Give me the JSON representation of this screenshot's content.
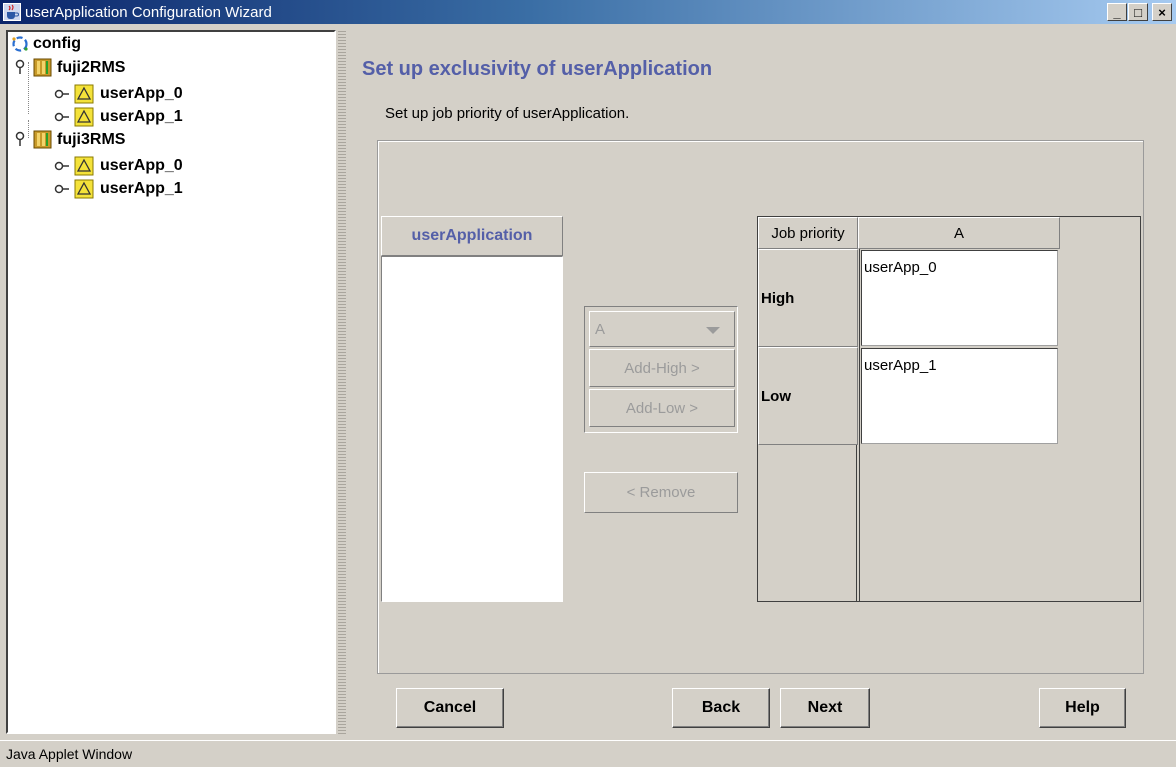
{
  "window": {
    "title": "userApplication Configuration Wizard",
    "icon": "java-cup-icon",
    "controls": [
      "_",
      "□",
      "×"
    ]
  },
  "tree": {
    "root": {
      "label": "config",
      "icon": "config-icon"
    },
    "nodes": [
      {
        "label": "fuji2RMS",
        "icon": "node-icon",
        "children": [
          {
            "label": "userApp_0",
            "icon": "userapp-icon"
          },
          {
            "label": "userApp_1",
            "icon": "userapp-icon"
          }
        ]
      },
      {
        "label": "fuji3RMS",
        "icon": "node-icon",
        "children": [
          {
            "label": "userApp_0",
            "icon": "userapp-icon"
          },
          {
            "label": "userApp_1",
            "icon": "userapp-icon"
          }
        ]
      }
    ]
  },
  "main": {
    "title": "Set up exclusivity of userApplication",
    "subtitle": "Set up job priority of userApplication.",
    "list_header": "userApplication",
    "list_items": [],
    "group_select": {
      "value": "A"
    },
    "add_high_label": "Add-High >",
    "add_low_label": "Add-Low >",
    "remove_label": "< Remove",
    "grid": {
      "header_priority": "Job priority",
      "header_group": "A",
      "rows": [
        {
          "priority": "High",
          "app": "userApp_0"
        },
        {
          "priority": "Low",
          "app": "userApp_1"
        }
      ]
    }
  },
  "footer": {
    "cancel_label": "Cancel",
    "back_label": "Back",
    "next_label": "Next",
    "help_label": "Help"
  },
  "status": "Java Applet Window",
  "colors": {
    "accent_text": "#545fa8",
    "titlebar_start": "#0a246a",
    "titlebar_end": "#a6caf0",
    "disabled_text": "#9b9b9b"
  }
}
